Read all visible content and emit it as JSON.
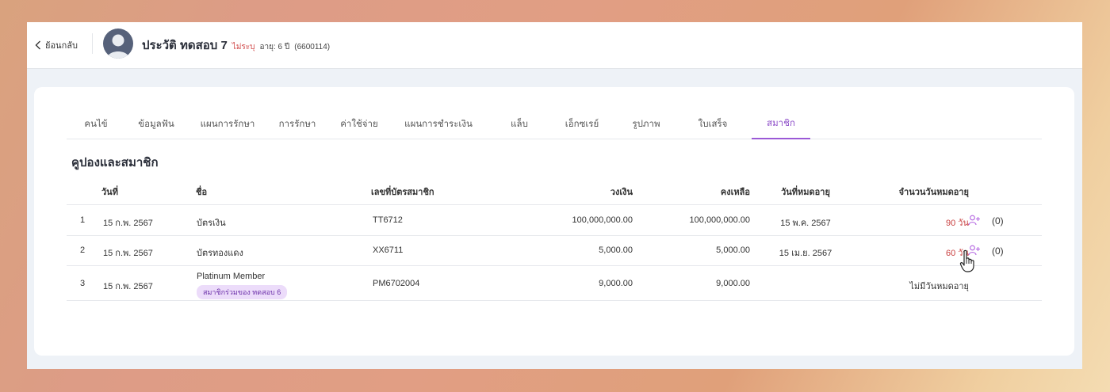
{
  "header": {
    "back_label": "ย้อนกลับ",
    "patient_name": "ประวัติ ทดสอบ 7",
    "gender": "ไม่ระบุ",
    "age": "อายุ: 6 ปี",
    "patient_id": "(6600114)"
  },
  "tabs": [
    {
      "label": "คนไข้"
    },
    {
      "label": "ข้อมูลฟัน"
    },
    {
      "label": "แผนการรักษา"
    },
    {
      "label": "การรักษา"
    },
    {
      "label": "ค่าใช้จ่าย"
    },
    {
      "label": "แผนการชำระเงิน"
    },
    {
      "label": "แล็บ"
    },
    {
      "label": "เอ็กซเรย์"
    },
    {
      "label": "รูปภาพ"
    },
    {
      "label": "ใบเสร็จ"
    },
    {
      "label": "สมาชิก",
      "active": true
    }
  ],
  "section_title": "คูปองและสมาชิก",
  "table": {
    "columns": [
      "วันที่",
      "ชื่อ",
      "เลขที่บัตรสมาชิก",
      "วงเงิน",
      "คงเหลือ",
      "วันที่หมดอายุ",
      "จำนวนวันหมดอายุ"
    ],
    "rows": [
      {
        "no": "1",
        "date": "15 ก.พ. 2567",
        "name": "บัตรเงิน",
        "card_no": "TT6712",
        "limit": "100,000,000.00",
        "balance": "100,000,000.00",
        "expiry": "15 พ.ค. 2567",
        "days_left": "90 วัน",
        "member_count": "(0)"
      },
      {
        "no": "2",
        "date": "15 ก.พ. 2567",
        "name": "บัตรทองแดง",
        "card_no": "XX6711",
        "limit": "5,000.00",
        "balance": "5,000.00",
        "expiry": "15 เม.ย. 2567",
        "days_left": "60 วัน",
        "member_count": "(0)"
      },
      {
        "no": "3",
        "date": "15 ก.พ. 2567",
        "name": "Platinum Member",
        "badge": "สมาชิกร่วมของ ทดสอบ 6",
        "card_no": "PM6702004",
        "limit": "9,000.00",
        "balance": "9,000.00",
        "expiry": "",
        "days_left": "ไม่มีวันหมดอายุ"
      }
    ]
  },
  "colors": {
    "accent": "#9b59d6",
    "overdue_red": "#c94040",
    "badge_bg": "#ecdcfa"
  }
}
